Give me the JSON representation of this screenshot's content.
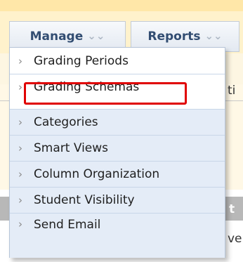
{
  "tabs": {
    "manage": {
      "label": "Manage",
      "chevron": "double-chevron-down-icon"
    },
    "reports": {
      "label": "Reports",
      "chevron": "double-chevron-down-icon"
    }
  },
  "menu": {
    "items": [
      {
        "label": "Grading Periods",
        "arrow": "›"
      },
      {
        "label": "Grading Schemas",
        "arrow": "›",
        "highlighted": true
      },
      {
        "label": "Categories",
        "arrow": "›"
      },
      {
        "label": "Smart Views",
        "arrow": "›"
      },
      {
        "label": "Column Organization",
        "arrow": "›"
      },
      {
        "label": "Student Visibility",
        "arrow": "›"
      },
      {
        "label": "Send Email",
        "arrow": "›"
      }
    ]
  },
  "background_clips": {
    "clip1": "ti",
    "clip2": "t",
    "clip3": "ve"
  },
  "colors": {
    "highlight_border": "#e00000",
    "tab_text": "#324d72",
    "menu_border": "#b7c5d8",
    "menu_shaded": "#e4ecf7"
  }
}
